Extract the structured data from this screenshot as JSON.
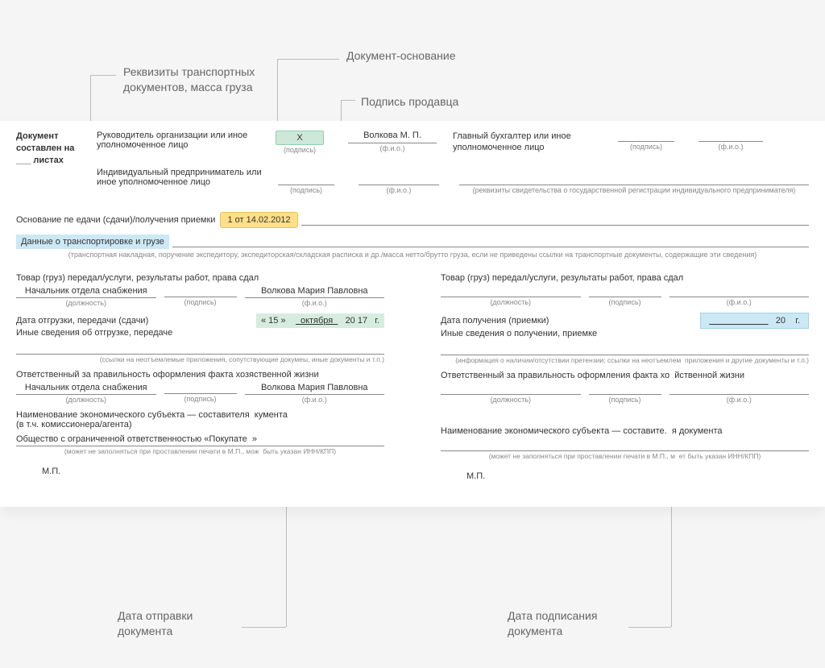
{
  "callouts": {
    "transport": "Реквизиты транспортных документов, масса груза",
    "basisDoc": "Документ-основание",
    "sellerSign": "Подпись продавца",
    "sendDate": "Дата отправки документа",
    "signDate": "Дата подписания документа"
  },
  "header": {
    "docNote": "Документ составлен на ___ листах",
    "leaderRole": "Руководитель организации или иное уполномоченное лицо",
    "ipRole": "Индивидуальный предприниматель или иное уполномоченное лицо",
    "signMark": "X",
    "leaderName": "Волкова М. П.",
    "accountant": "Главный бухгалтер или иное уполномоченное лицо",
    "signLabel": "(подпись)",
    "fioLabel": "(ф.и.о.)",
    "ipNote": "(реквизиты свидетельства о государственной регистрации индивидуального предпринимателя)"
  },
  "basis": {
    "label": "Основание пе   едачи (сдачи)/получения приемки",
    "value": "1 от 14.02.2012"
  },
  "transport": {
    "label": "Данные о транспортировке и грузе",
    "note": "(транспортная накладная, поручение экспедитору, экспедиторская/складская расписка и др./масса нетто/брутто груза, если не приведены ссылки на транспортные документы, содержащие эти сведения)"
  },
  "left": {
    "title": "Товар (груз) передал/услуги, результаты работ, права сдал",
    "position": "Начальник отдела снабжения",
    "fullName": "Волкова Мария Павловна",
    "positionLbl": "(должность)",
    "signLbl": "(подпись)",
    "fioLbl": "(ф.и.о.)",
    "shipDateLbl": "Дата отгрузки, передачи (сдачи)",
    "shipDate": {
      "day": "15",
      "month": "октября",
      "year": "20 17",
      "suffix": "г."
    },
    "otherLbl": "Иные сведения об отгрузке, передаче",
    "otherNote": "(ссылки на неотъемлемые приложения, сопутствующие докуме",
    "otherNote2": "ы, иные документы и т.п.)",
    "respLbl": "Ответственный за правильность оформления факта хозя",
    "respLbl2": "ственной жизни",
    "position2": "Начальник отдела снабжения",
    "fullName2": "Волкова Мария Павловна",
    "entityLbl": "Наименование экономического субъекта — составителя",
    "entityLbl2": "кумента",
    "entitySub": "(в т.ч. комиссионера/агента)",
    "entityName": "Общество с ограниченной ответственностью «Покупате",
    "entityName2": "»",
    "entityNote": "(может не заполняться при проставлении печати в М.П., мож",
    "entityNote2": "быть указан ИНН/КПП)",
    "mp": "М.П."
  },
  "right": {
    "title": "Товар (груз) передал/услуги, результаты работ, права сдал",
    "positionLbl": "(должность)",
    "signLbl": "(подпись)",
    "fioLbl": "(ф.и.о.)",
    "recvDateLbl": "Дата получения (приемки)",
    "recvDate": {
      "year": "20",
      "suffix": "г."
    },
    "otherLbl": "Иные сведения о получении, приемке",
    "otherNote": "(информация о наличии/отсутствии претензии; ссылки на неотъемлем",
    "otherNote2": "приложения и другие документы и т.п.)",
    "respLbl": "Ответственный за правильность оформления факта хо",
    "respLbl2": "йственной жизни",
    "entityLbl": "Наименование экономического субъекта — составите.",
    "entityLbl2": "я документа",
    "entityNote": "(может не заполняться при проставлении печати в М.П., м",
    "entityNote2": "ет быть указан ИНН/КПП)",
    "mp": "М.П."
  }
}
